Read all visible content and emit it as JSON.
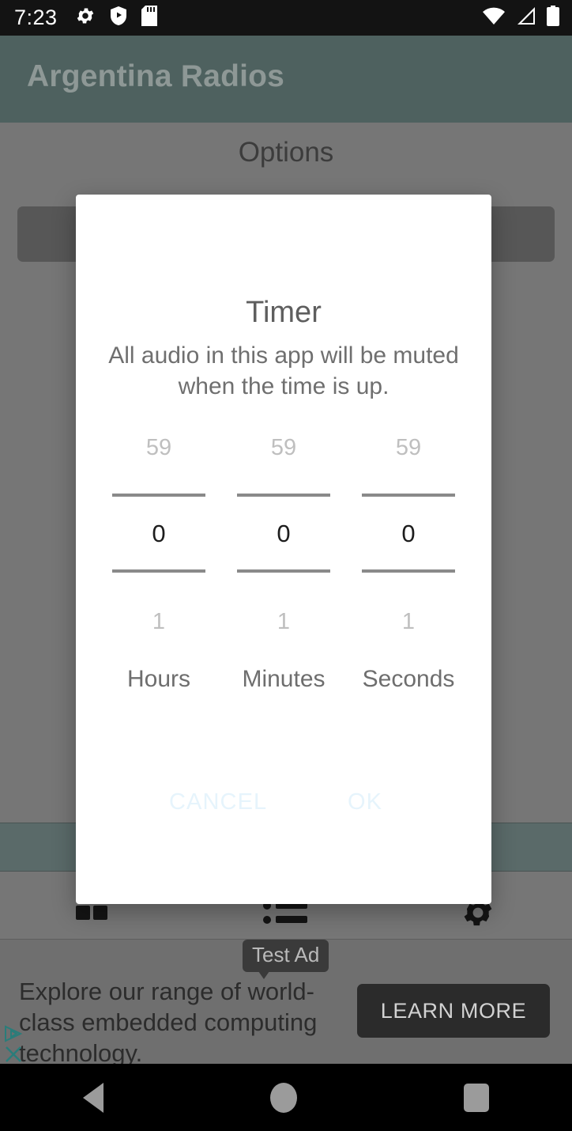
{
  "status_bar": {
    "time": "7:23",
    "left_icons": [
      "gear-icon",
      "shield-play-icon",
      "sd-card-icon"
    ],
    "right_icons": [
      "wifi-icon",
      "cellular-signal-icon",
      "battery-icon"
    ],
    "background": "#131313"
  },
  "app": {
    "title": "Argentina Radios",
    "appbar_color": "#4e615f",
    "options_header": "Options",
    "bottom_toolbar": [
      "grid-icon",
      "list-icon",
      "gear-icon"
    ]
  },
  "dialog": {
    "title": "Timer",
    "message": "All audio in this app will be muted when the time is up.",
    "pickers": [
      {
        "prev": "59",
        "value": "0",
        "next": "1",
        "label": "Hours"
      },
      {
        "prev": "59",
        "value": "0",
        "next": "1",
        "label": "Minutes"
      },
      {
        "prev": "59",
        "value": "0",
        "next": "1",
        "label": "Seconds"
      }
    ],
    "cancel_label": "CANCEL",
    "ok_label": "OK",
    "button_color": "#e6f4fc",
    "divider_color": "#8a8a8a",
    "background": "#ffffff"
  },
  "ad": {
    "badge": "Test Ad",
    "text": "Explore our range of world-class embedded computing technology.",
    "cta_label": "LEARN MORE",
    "adchoices_icon": "adchoices-triangle-icon",
    "close_icon": "close-x-icon",
    "accent_color": "#2a7d7a"
  },
  "nav_bar": {
    "back": "back-triangle-icon",
    "home": "home-circle-icon",
    "recents": "recents-square-icon"
  }
}
